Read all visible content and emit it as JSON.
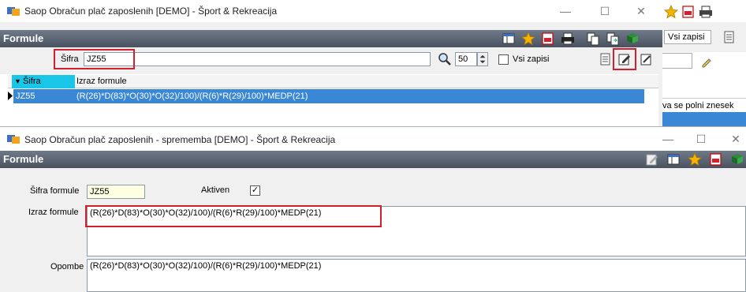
{
  "main_window": {
    "title": "Saop Obračun plač zaposlenih [DEMO] - Šport & Rekreacija",
    "controls": {
      "minimize": "—",
      "maximize": "☐",
      "close": "✕"
    },
    "section_title": "Formule",
    "search": {
      "label": "Šifra",
      "value": "JZ55",
      "page_size": "50",
      "vsi_zapisi_label": "Vsi zapisi"
    },
    "grid": {
      "columns": [
        "Šifra",
        "Izraz formule"
      ],
      "rows": [
        {
          "sifra": "JZ55",
          "izraz": "(R(26)*D(83)*O(30)*O(32)/100)/(R(6)*R(29)/100)*MEDP(21)"
        }
      ]
    }
  },
  "behind_window": {
    "vsi_zapisi_label": "Vsi zapisi",
    "column_label": "va se polni znesek"
  },
  "edit_window": {
    "title": "Saop Obračun plač zaposlenih - sprememba [DEMO] - Šport & Rekreacija",
    "controls": {
      "minimize": "—",
      "maximize": "☐",
      "close": "✕"
    },
    "section_title": "Formule",
    "sifra_label": "Šifra formule",
    "sifra_value": "JZ55",
    "aktiven_label": "Aktiven",
    "aktiven_mark": "✓",
    "izraz_label": "Izraz formule",
    "izraz_value": "(R(26)*D(83)*O(30)*O(32)/100)/(R(6)*R(29)/100)*MEDP(21)",
    "opombe_label": "Opombe",
    "opombe_value": "(R(26)*D(83)*O(30)*O(32)/100)/(R(6)*R(29)/100)*MEDP(21)"
  },
  "colors": {
    "header_dark": "#4a5260",
    "selection_blue": "#3a87d6",
    "highlight_red": "#d2202e",
    "field_yellow": "#ffffe1"
  }
}
